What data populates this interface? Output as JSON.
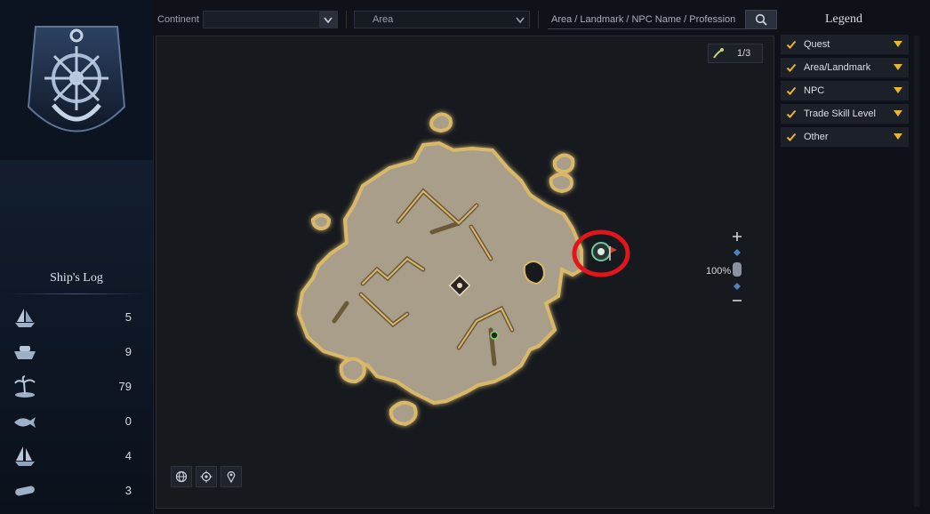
{
  "left_panel": {
    "emblem_icon": "anchor-helm-emblem-icon",
    "ships_log_title": "Ship's Log",
    "log_rows": [
      {
        "icon": "sailing-ship-icon",
        "count": "5"
      },
      {
        "icon": "boat-icon",
        "count": "9"
      },
      {
        "icon": "palm-island-icon",
        "count": "79"
      },
      {
        "icon": "whale-icon",
        "count": "0"
      },
      {
        "icon": "ghost-ship-icon",
        "count": "4"
      },
      {
        "icon": "scroll-icon",
        "count": "3"
      }
    ]
  },
  "top_bar": {
    "continent_label": "Continent",
    "continent_value": "",
    "area_value": "Area",
    "search_placeholder": "Area / Landmark / NPC Name / Profession",
    "search_icon": "search-icon"
  },
  "map": {
    "page_indicator": "1/3",
    "zoom_level": "100%",
    "tools": [
      "globe-icon",
      "locate-icon",
      "pin-icon"
    ],
    "colors": {
      "land": "#a89e8a",
      "coast": "#d9b86a",
      "water": "#161a1f",
      "highlight_ring": "#e0161b"
    }
  },
  "legend": {
    "title": "Legend",
    "items": [
      {
        "label": "Quest",
        "checked": true
      },
      {
        "label": "Area/Landmark",
        "checked": true
      },
      {
        "label": "NPC",
        "checked": true
      },
      {
        "label": "Trade Skill Level",
        "checked": true
      },
      {
        "label": "Other",
        "checked": true
      }
    ],
    "accent_color": "#e8b532"
  }
}
